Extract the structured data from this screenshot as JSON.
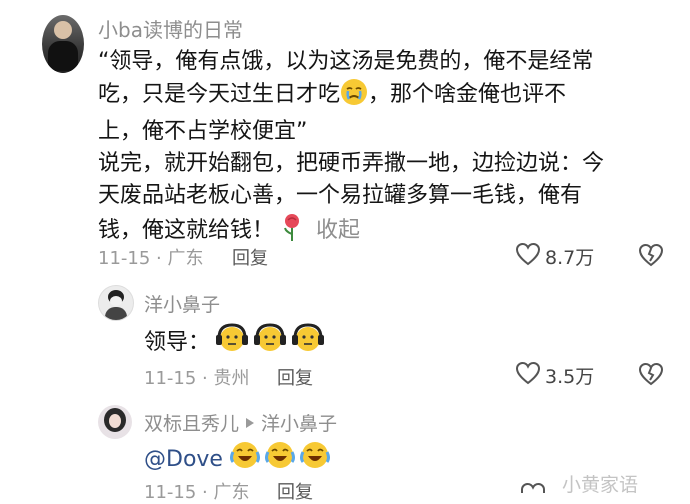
{
  "comments": [
    {
      "user": "小ba读博的日常",
      "lines": [
        "“领导，俺有点饿，以为这汤是免费的，俺不是经常",
        "吃，只是今天过生日才吃",
        "，那个啥金俺也评不",
        "上，俺不占学校便宜”",
        "说完，就开始翻包，把硬币弄撒一地，边捡边说：今",
        "天废品站老板心善，一个易拉罐多算一毛钱，俺有",
        "钱，俺这就给钱！"
      ],
      "emojis": [
        "crying-face",
        "rose"
      ],
      "collapse_label": "收起",
      "date_location": "11-15 · 广东",
      "reply_label": "回复",
      "like_count": "8.7万"
    },
    {
      "user": "洋小鼻子",
      "text": "领导：",
      "emojis": [
        "headphone-face",
        "headphone-face",
        "headphone-face"
      ],
      "date_location": "11-15 · 贵州",
      "reply_label": "回复",
      "like_count": "3.5万"
    },
    {
      "user": "双标且秀儿",
      "reply_to": "洋小鼻子",
      "text": "@Dove",
      "emojis": [
        "tears-of-joy",
        "tears-of-joy",
        "tears-of-joy"
      ],
      "date_location": "11-15 · 广东",
      "reply_label": "回复"
    }
  ],
  "watermark": "小黄家语",
  "icons": [
    "heart-icon",
    "broken-heart-icon",
    "reply-arrow-icon"
  ],
  "colors": {
    "emoji_yellow": "#f7c934",
    "rose": "#e64a5a",
    "mention": "#2f4f88"
  }
}
